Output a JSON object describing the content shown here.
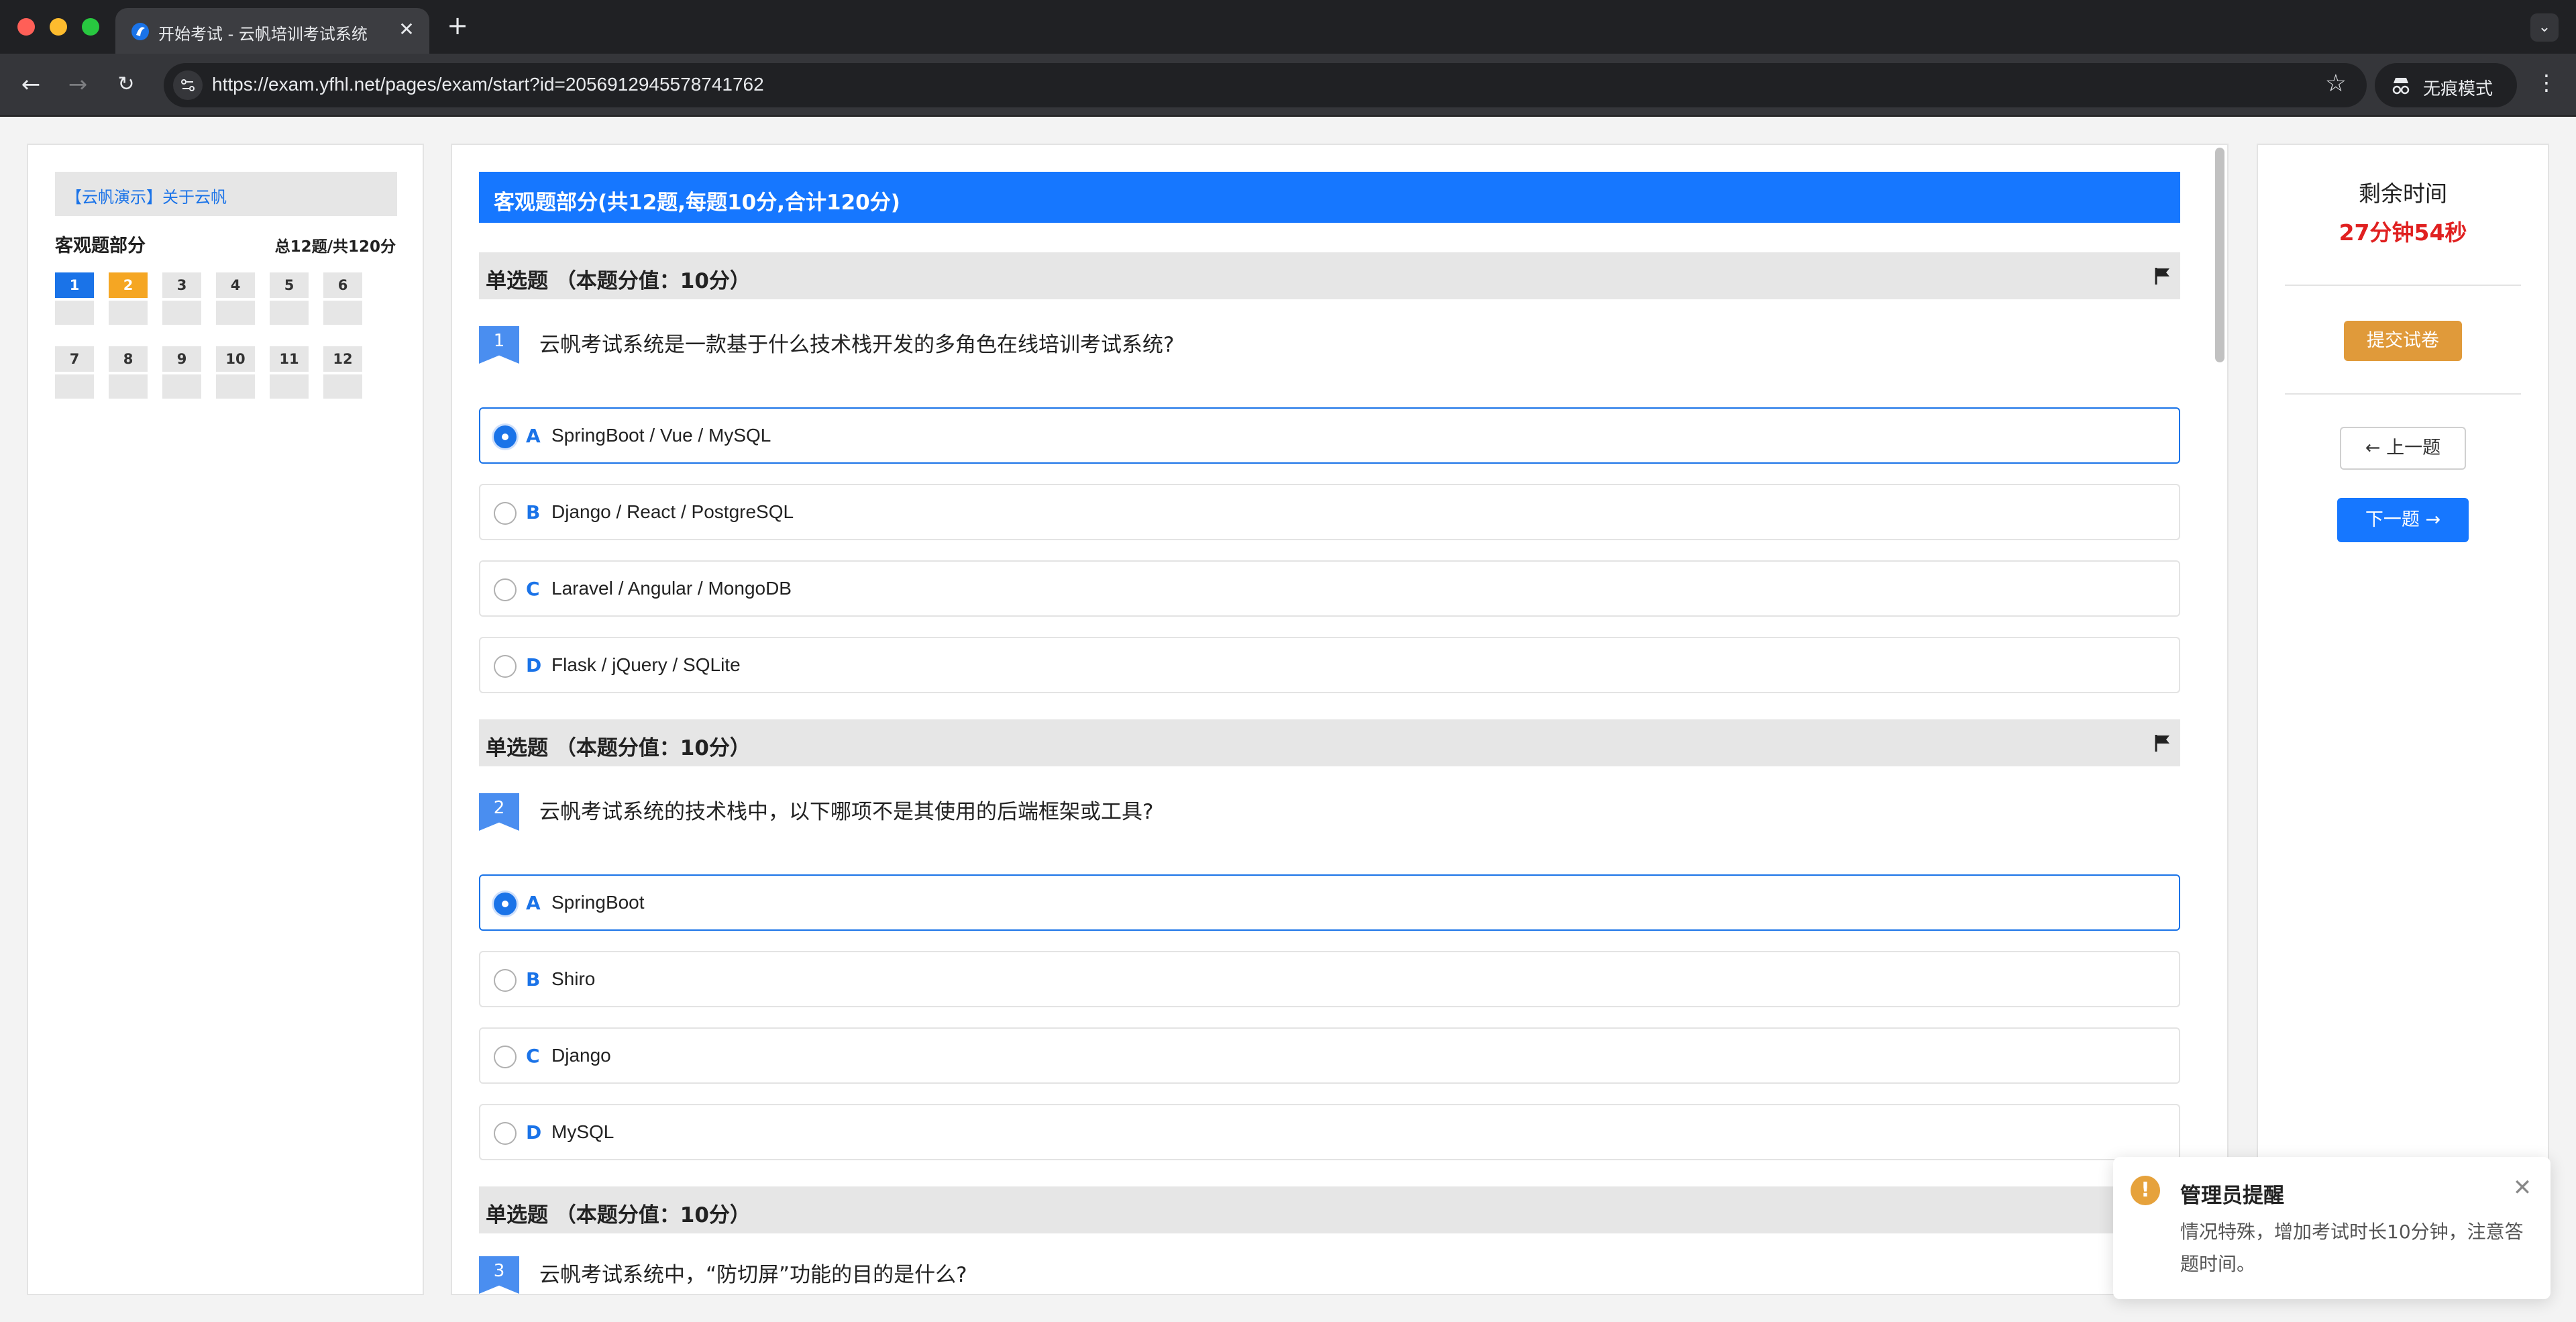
{
  "browser": {
    "tab_title": "开始考试 - 云帆培训考试系统",
    "url": "https://exam.yfhl.net/pages/exam/start?id=2056912945578741762",
    "incognito_label": "无痕模式",
    "icons": [
      "back-icon",
      "forward-icon",
      "reload-icon",
      "site-info-icon",
      "star-icon",
      "incognito-icon",
      "menu-icon"
    ]
  },
  "left_panel": {
    "exam_title": "【云帆演示】关于云帆",
    "section_label": "客观题部分",
    "section_total": "总12题/共120分",
    "questions": [
      {
        "num": "1",
        "state": "answered"
      },
      {
        "num": "2",
        "state": "current"
      },
      {
        "num": "3",
        "state": "unanswered"
      },
      {
        "num": "4",
        "state": "unanswered"
      },
      {
        "num": "5",
        "state": "unanswered"
      },
      {
        "num": "6",
        "state": "unanswered"
      },
      {
        "num": "7",
        "state": "unanswered"
      },
      {
        "num": "8",
        "state": "unanswered"
      },
      {
        "num": "9",
        "state": "unanswered"
      },
      {
        "num": "10",
        "state": "unanswered"
      },
      {
        "num": "11",
        "state": "unanswered"
      },
      {
        "num": "12",
        "state": "unanswered"
      }
    ]
  },
  "main": {
    "part_banner": "客观题部分(共12题,每题10分,合计120分)",
    "questions": [
      {
        "header": "单选题 （本题分值：10分）",
        "number": "1",
        "text": "云帆考试系统是一款基于什么技术栈开发的多角色在线培训考试系统?",
        "options": [
          {
            "letter": "A",
            "text": "SpringBoot / Vue / MySQL",
            "selected": true
          },
          {
            "letter": "B",
            "text": "Django / React / PostgreSQL",
            "selected": false
          },
          {
            "letter": "C",
            "text": "Laravel / Angular / MongoDB",
            "selected": false
          },
          {
            "letter": "D",
            "text": "Flask / jQuery / SQLite",
            "selected": false
          }
        ]
      },
      {
        "header": "单选题 （本题分值：10分）",
        "number": "2",
        "text": "云帆考试系统的技术栈中，以下哪项不是其使用的后端框架或工具?",
        "options": [
          {
            "letter": "A",
            "text": "SpringBoot",
            "selected": true
          },
          {
            "letter": "B",
            "text": "Shiro",
            "selected": false
          },
          {
            "letter": "C",
            "text": "Django",
            "selected": false
          },
          {
            "letter": "D",
            "text": "MySQL",
            "selected": false
          }
        ]
      },
      {
        "header": "单选题 （本题分值：10分）",
        "number": "3",
        "text": "云帆考试系统中，“防切屏”功能的目的是什么?",
        "options": []
      }
    ]
  },
  "right_panel": {
    "time_label": "剩余时间",
    "time_value": "27分钟54秒",
    "submit_label": "提交试卷",
    "prev_label": "← 上一题",
    "next_label": "下一题 →"
  },
  "notification": {
    "title": "管理员提醒",
    "body": "情况特殊，增加考试时长10分钟，注意答题时间。",
    "icon": "warning-icon"
  },
  "colors": {
    "primary": "#1677ff",
    "answered": "#1a73e8",
    "current": "#f5a623",
    "submit": "#e09a3a",
    "time": "#e02020",
    "warning": "#e6a23c"
  }
}
